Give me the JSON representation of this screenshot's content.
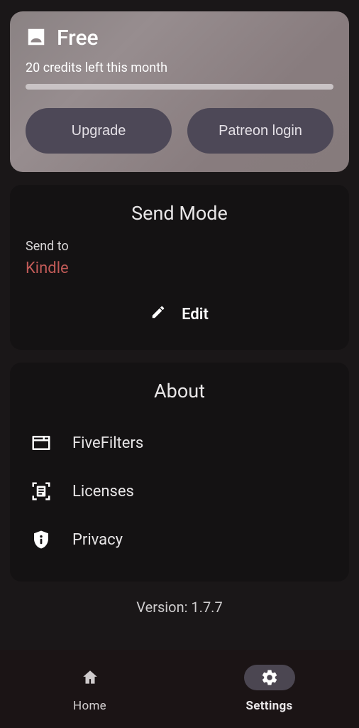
{
  "account": {
    "plan": "Free",
    "credits_text": "20 credits left this month",
    "upgrade_label": "Upgrade",
    "patreon_label": "Patreon login"
  },
  "send_mode": {
    "title": "Send Mode",
    "label": "Send to",
    "value": "Kindle",
    "edit_label": "Edit"
  },
  "about": {
    "title": "About",
    "items": [
      {
        "label": "FiveFilters"
      },
      {
        "label": "Licenses"
      },
      {
        "label": "Privacy"
      }
    ]
  },
  "version_text": "Version: 1.7.7",
  "nav": {
    "home": "Home",
    "settings": "Settings"
  },
  "colors": {
    "accent_red": "#c05a57",
    "pill_bg": "#4d4857",
    "nav_active_bg": "#4b4651"
  }
}
